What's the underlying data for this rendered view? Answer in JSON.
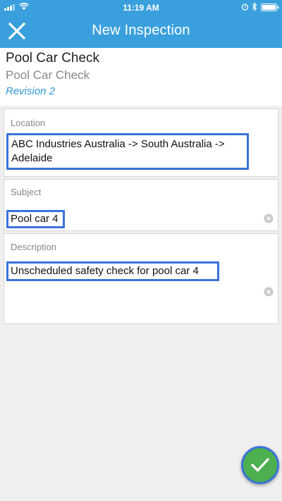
{
  "status_bar": {
    "time": "11:19 AM"
  },
  "nav": {
    "title": "New Inspection",
    "close_icon": "close-icon"
  },
  "form": {
    "name": "Pool Car Check",
    "subname": "Pool Car Check",
    "revision": "Revision 2"
  },
  "fields": {
    "location": {
      "label": "Location",
      "value_line1": "ABC Industries Australia -> South Australia ->",
      "value_line2": "Adelaide"
    },
    "subject": {
      "label": "Subject",
      "value": "Pool car 4"
    },
    "description": {
      "label": "Description",
      "value": "Unscheduled safety check for pool car 4"
    }
  },
  "submit": {
    "icon": "checkmark-icon"
  },
  "colors": {
    "header": "#3aa0dd",
    "revision": "#2e9bd6",
    "highlight": "#3b72d9",
    "fab": "#4caf50"
  }
}
